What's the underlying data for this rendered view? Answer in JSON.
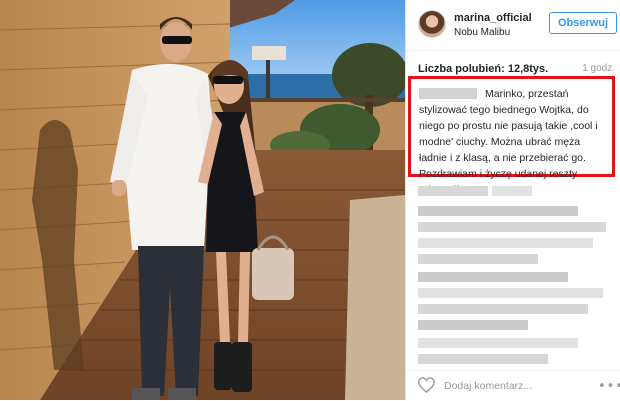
{
  "post": {
    "username": "marina_official",
    "location": "Nobu Malibu",
    "follow_label": "Obserwuj",
    "likes": "Liczba polubień: 12,8tys.",
    "time": "1 godz.",
    "highlighted_comment": "Marinko, przestań stylizować tego biednego Wojtka, do niego po prostu nie pasują takie ,cool i modne' ciuchy. Można ubrać męża ładnie i z klasą, a nie przebierać go. Pozdrawiam i życzę udanej reszty urlopu :))",
    "comment_placeholder": "Dodaj komentarz...",
    "more_symbol": "•••"
  },
  "colors": {
    "follow_blue": "#3897f0",
    "highlight_red": "#e8111a"
  },
  "icons": {
    "heart": "heart-icon",
    "more": "more-icon"
  }
}
